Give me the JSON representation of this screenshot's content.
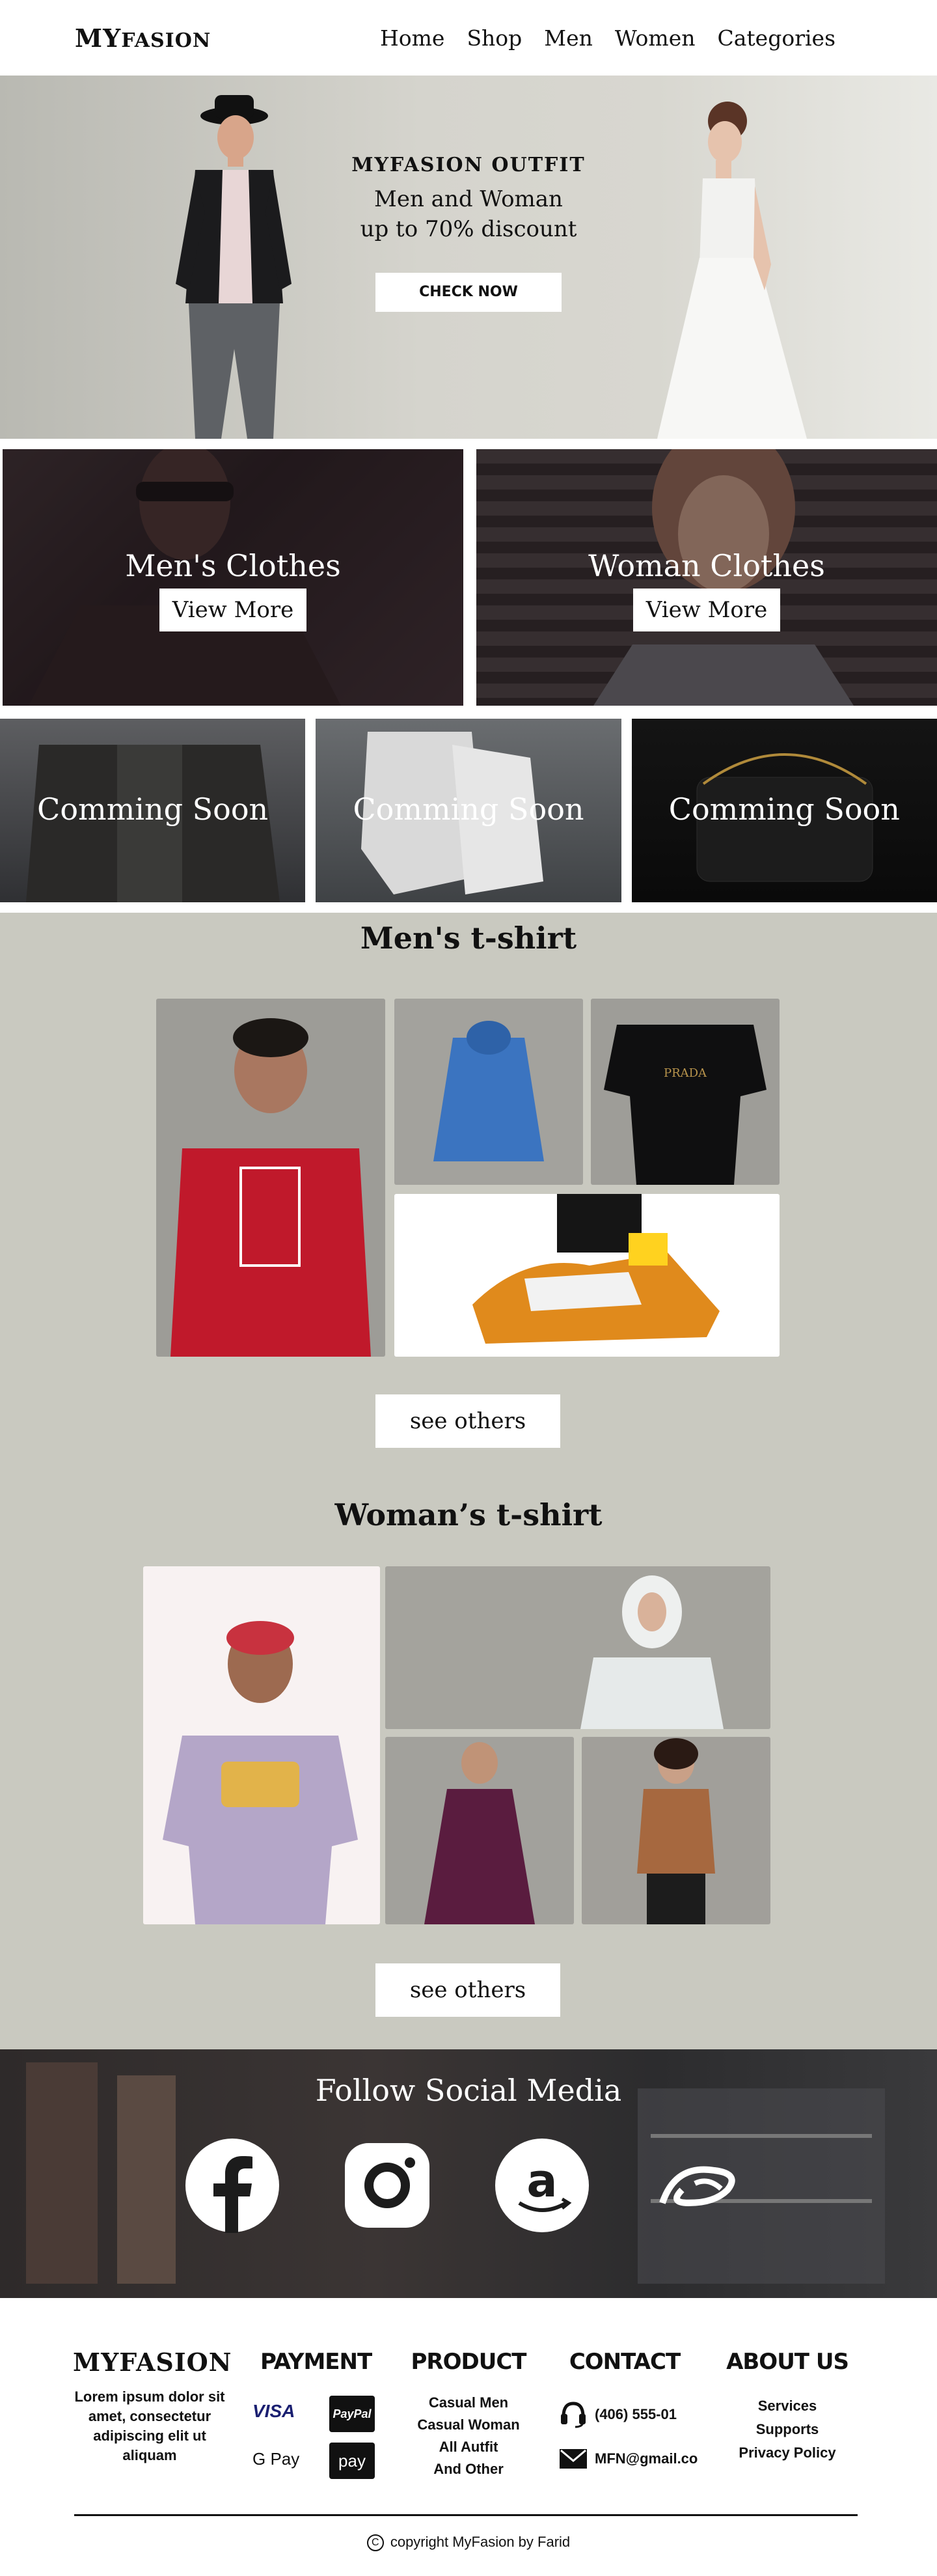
{
  "nav": {
    "logo_big": "MY",
    "logo_small": "FASION",
    "items": [
      "Home",
      "Shop",
      "Men",
      "Women",
      "Categories"
    ]
  },
  "hero": {
    "brand": "MYFASION OUTFIT",
    "line1": "Men and Woman",
    "line2": "up to 70% discount",
    "cta": "CHECK NOW"
  },
  "categories": [
    {
      "title": "Men's Clothes",
      "button": "View More"
    },
    {
      "title": "Woman Clothes",
      "button": "View More"
    }
  ],
  "coming_soon": [
    "Comming Soon",
    "Comming Soon",
    "Comming Soon"
  ],
  "men_section": {
    "title": "Men's t-shirt",
    "button": "see others"
  },
  "women_section": {
    "title": "Woman’s t-shirt",
    "button": "see others"
  },
  "social": {
    "title": "Follow Social Media"
  },
  "footer": {
    "logo": "MYFASION",
    "about_text": "Lorem ipsum dolor sit amet, consectetur adipiscing elit ut aliquam",
    "payment": {
      "title": "PAYMENT",
      "items": [
        "VISA",
        "PayPal",
        "G Pay",
        "pay"
      ]
    },
    "product": {
      "title": "PRODUCT",
      "items": [
        "Casual Men",
        "Casual Woman",
        "All Autfit",
        "And Other"
      ]
    },
    "contact": {
      "title": "CONTACT",
      "phone": "(406) 555-01",
      "email": "MFN@gmail.co"
    },
    "about": {
      "title": "ABOUT US",
      "items": [
        "Services",
        "Supports",
        "Privacy Policy"
      ]
    },
    "copyright": "copyright MyFasion by Farid"
  },
  "colors": {
    "section_bg": "#c9c9c0",
    "accent": "#ffffff",
    "text": "#111111"
  }
}
